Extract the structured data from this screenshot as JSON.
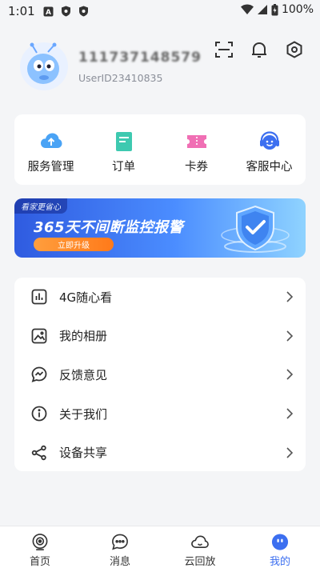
{
  "status_bar": {
    "time": "1:01",
    "battery": "100%"
  },
  "profile": {
    "username": "111737148579",
    "user_id": "UserID23410835"
  },
  "quick_actions": [
    {
      "label": "服务管理",
      "icon": "cloud-upload-icon"
    },
    {
      "label": "订单",
      "icon": "order-document-icon"
    },
    {
      "label": "卡券",
      "icon": "coupon-ticket-icon"
    },
    {
      "label": "客服中心",
      "icon": "customer-service-icon"
    }
  ],
  "banner": {
    "tag": "看家更省心",
    "title": "365天不间断监控报警",
    "button": "立即升级"
  },
  "menu": [
    {
      "label": "4G随心看",
      "icon": "bar-chart-icon"
    },
    {
      "label": "我的相册",
      "icon": "photo-album-icon"
    },
    {
      "label": "反馈意见",
      "icon": "feedback-chat-icon"
    },
    {
      "label": "关于我们",
      "icon": "info-icon"
    },
    {
      "label": "设备共享",
      "icon": "share-icon"
    }
  ],
  "tabs": [
    {
      "label": "首页",
      "icon": "home-camera-icon",
      "active": false
    },
    {
      "label": "消息",
      "icon": "message-icon",
      "active": false
    },
    {
      "label": "云回放",
      "icon": "cloud-playback-icon",
      "active": false
    },
    {
      "label": "我的",
      "icon": "profile-icon",
      "active": true
    }
  ],
  "colors": {
    "accent": "#3c6ff0",
    "banner_button": "#ff8a2a",
    "background": "#f4f5f7"
  }
}
